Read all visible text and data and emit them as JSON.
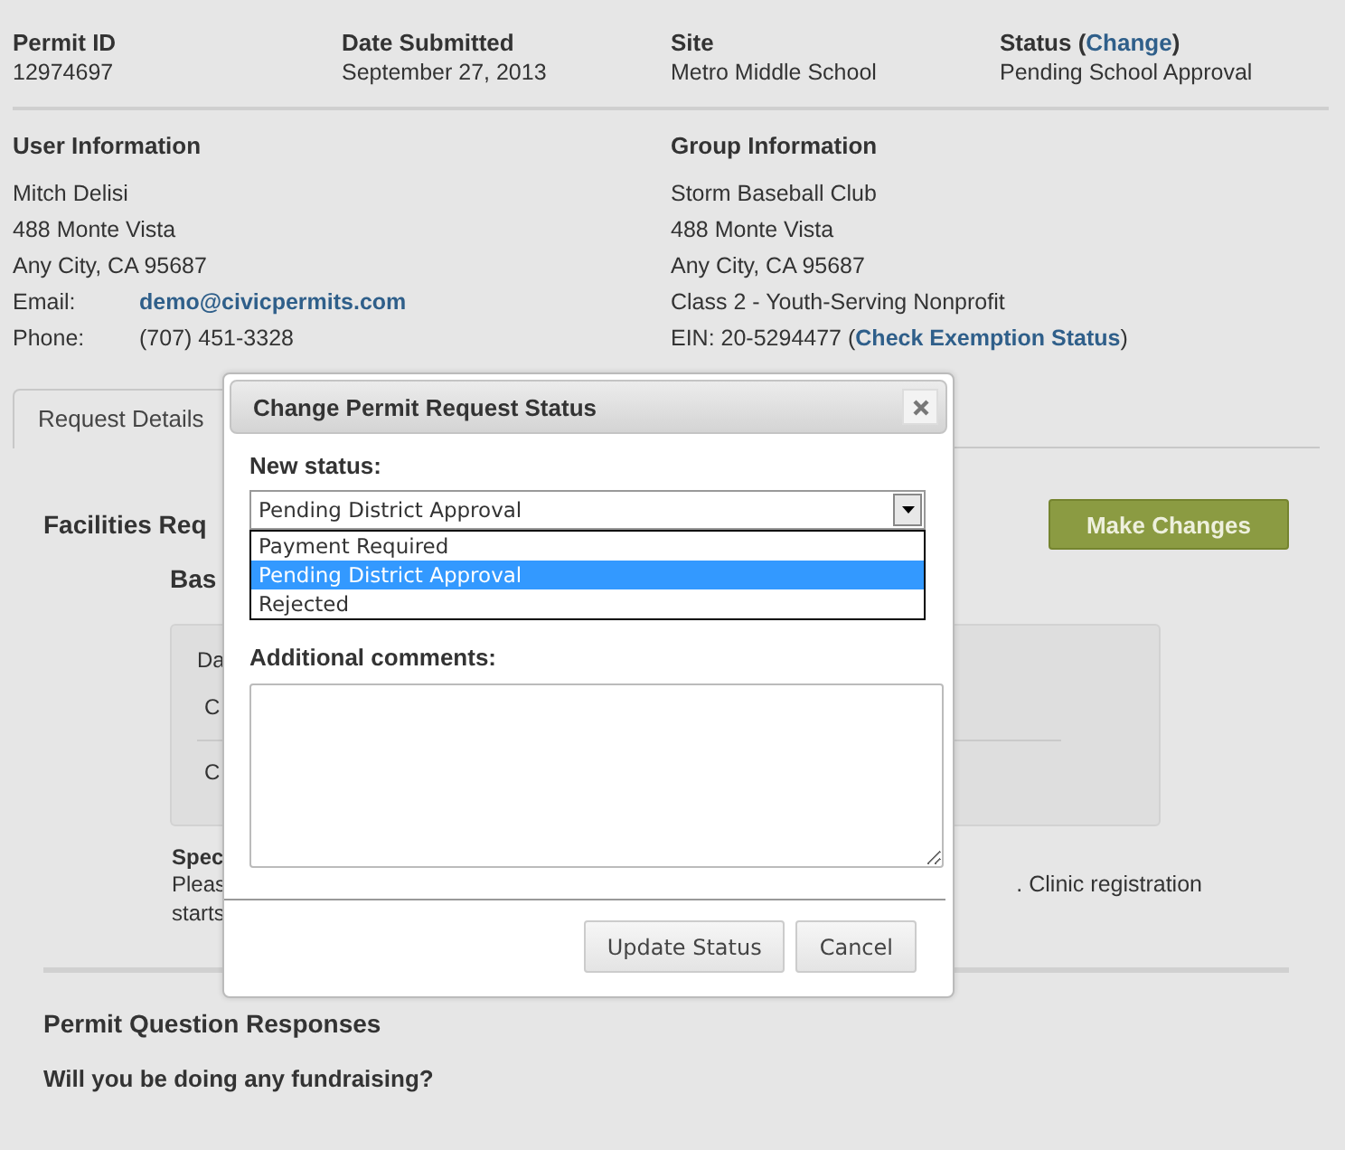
{
  "header": [
    {
      "label": "Permit ID",
      "value": "12974697"
    },
    {
      "label": "Date Submitted",
      "value": "September 27, 2013"
    },
    {
      "label": "Site",
      "value": "Metro Middle School"
    },
    {
      "label": "Status (",
      "link": "Change",
      "label_after": ")",
      "value": "Pending School Approval"
    }
  ],
  "user_info": {
    "title": "User Information",
    "lines": [
      {
        "kind": "text",
        "text": "Mitch Delisi"
      },
      {
        "kind": "text",
        "text": "488 Monte Vista"
      },
      {
        "kind": "text",
        "text": "Any City, CA 95687"
      },
      {
        "kind": "link_field",
        "label": "Email:",
        "value": "demo@civicpermits.com"
      },
      {
        "kind": "field",
        "label": "Phone:",
        "value": "(707) 451-3328"
      }
    ]
  },
  "group_info": {
    "title": "Group Information",
    "lines": [
      {
        "kind": "text",
        "text": "Storm Baseball Club"
      },
      {
        "kind": "text",
        "text": "488 Monte Vista"
      },
      {
        "kind": "text",
        "text": "Any City, CA 95687"
      },
      {
        "kind": "text",
        "text": "Class 2 - Youth-Serving Nonprofit"
      },
      {
        "kind": "linked",
        "text": "EIN: 20-5294477 (",
        "link": "Check Exemption Status",
        "after": ")"
      }
    ]
  },
  "tabs": [
    {
      "label": "Request Details",
      "selected": true
    }
  ],
  "details": {
    "heading": "Facilities Req",
    "make_changes": "Make Changes",
    "subheading": "Bas",
    "box_lines": [
      "Da",
      "C",
      "C"
    ],
    "note_title": "Spec",
    "note_left": [
      "Pleas",
      "starts"
    ],
    "note_right": ". Clinic registration"
  },
  "questions": {
    "title": "Permit Question Responses",
    "question": "Will you be doing any fundraising?"
  },
  "dialog": {
    "title": "Change Permit Request Status",
    "status_label": "New status:",
    "status_value": "Pending District Approval",
    "options": [
      {
        "label": "Payment Required",
        "selected": false
      },
      {
        "label": "Pending District Approval",
        "selected": true
      },
      {
        "label": "Rejected",
        "selected": false
      }
    ],
    "comments_label": "Additional comments:",
    "buttons": [
      "Update Status",
      "Cancel"
    ]
  }
}
